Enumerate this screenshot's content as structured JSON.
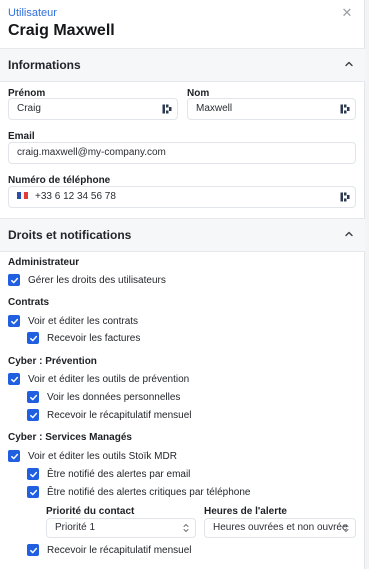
{
  "header": {
    "eyebrow": "Utilisateur",
    "title": "Craig Maxwell"
  },
  "info": {
    "section_title": "Informations",
    "first_name_label": "Prénom",
    "first_name_value": "Craig",
    "last_name_label": "Nom",
    "last_name_value": "Maxwell",
    "email_label": "Email",
    "email_value": "craig.maxwell@my-company.com",
    "phone_label": "Numéro de téléphone",
    "phone_value": "+33 6 12 34 56 78"
  },
  "rights": {
    "section_title": "Droits et notifications",
    "admin": {
      "label": "Administrateur",
      "items": [
        "Gérer les droits des utilisateurs"
      ]
    },
    "contracts": {
      "label": "Contrats",
      "items": [
        "Voir et éditer les contrats",
        "Recevoir les factures"
      ]
    },
    "prevention": {
      "label": "Cyber : Prévention",
      "items": [
        "Voir et éditer les outils de prévention",
        "Voir les données personnelles",
        "Recevoir le récapitulatif mensuel"
      ]
    },
    "managed": {
      "label": "Cyber : Services Managés",
      "items": [
        "Voir et éditer les outils Stoïk MDR",
        "Être notifié des alertes par email",
        "Être notifié des alertes critiques par téléphone",
        "Recevoir le récapitulatif mensuel"
      ],
      "priority_label": "Priorité du contact",
      "priority_value": "Priorité 1",
      "hours_label": "Heures de l'alerte",
      "hours_value": "Heures ouvrées et non ouvrée"
    }
  },
  "colors": {
    "accent": "#1f5fe0",
    "link": "#2f6fdc",
    "flag_blue": "#2a4fa8",
    "flag_red": "#e23b3b"
  },
  "icons": {
    "close": "close-icon",
    "collapse": "chevron-up-icon",
    "autofill": "password-manager-icon",
    "checkbox": "checkmark-icon",
    "select": "select-updown-icon"
  }
}
